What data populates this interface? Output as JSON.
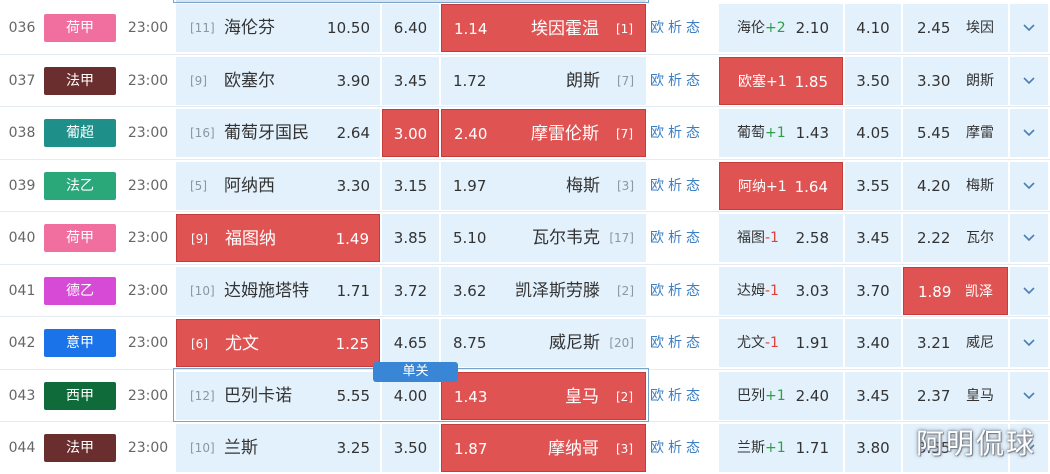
{
  "colors": {
    "cell_bg": "#e3f1fc",
    "selected_bg": "#e05353",
    "link": "#3b7fc4",
    "plus": "#2ea043",
    "minus": "#e0413a"
  },
  "links": {
    "ou": "欧",
    "xi": "析",
    "tai": "态"
  },
  "badge": "单关",
  "watermark": "阿明侃球",
  "expand_icon": "chevron-down-icon",
  "matches": [
    {
      "num": "036",
      "league": "荷甲",
      "league_color": "#f06f9e",
      "time": "23:00",
      "home_rank": "[11]",
      "home": "海伦芬",
      "home_odd": "10.50",
      "draw_odd": "6.40",
      "away_odd": "1.14",
      "away": "埃因霍温",
      "away_rank": "[1]",
      "hc_team": "海伦",
      "hc_sign": "+2",
      "hc_win": "2.10",
      "hc_draw": "4.10",
      "hc_lose": "2.45",
      "hc_away": "埃因",
      "sel": [
        "away"
      ],
      "hsel": []
    },
    {
      "num": "037",
      "league": "法甲",
      "league_color": "#6b2e2e",
      "time": "23:00",
      "home_rank": "[9]",
      "home": "欧塞尔",
      "home_odd": "3.90",
      "draw_odd": "3.45",
      "away_odd": "1.72",
      "away": "朗斯",
      "away_rank": "[7]",
      "hc_team": "欧塞",
      "hc_sign": "+1",
      "hc_win": "1.85",
      "hc_draw": "3.50",
      "hc_lose": "3.30",
      "hc_away": "朗斯",
      "sel": [],
      "hsel": [
        "c1"
      ]
    },
    {
      "num": "038",
      "league": "葡超",
      "league_color": "#1f8f8a",
      "time": "23:00",
      "home_rank": "[16]",
      "home": "葡萄牙国民",
      "home_odd": "2.64",
      "draw_odd": "3.00",
      "away_odd": "2.40",
      "away": "摩雷伦斯",
      "away_rank": "[7]",
      "hc_team": "葡萄",
      "hc_sign": "+1",
      "hc_win": "1.43",
      "hc_draw": "4.05",
      "hc_lose": "5.45",
      "hc_away": "摩雷",
      "sel": [
        "draw",
        "away"
      ],
      "hsel": []
    },
    {
      "num": "039",
      "league": "法乙",
      "league_color": "#2aa87a",
      "time": "23:00",
      "home_rank": "[5]",
      "home": "阿纳西",
      "home_odd": "3.30",
      "draw_odd": "3.15",
      "away_odd": "1.97",
      "away": "梅斯",
      "away_rank": "[3]",
      "hc_team": "阿纳",
      "hc_sign": "+1",
      "hc_win": "1.64",
      "hc_draw": "3.55",
      "hc_lose": "4.20",
      "hc_away": "梅斯",
      "sel": [],
      "hsel": [
        "c1"
      ]
    },
    {
      "num": "040",
      "league": "荷甲",
      "league_color": "#f06f9e",
      "time": "23:00",
      "home_rank": "[9]",
      "home": "福图纳",
      "home_odd": "1.49",
      "draw_odd": "3.85",
      "away_odd": "5.10",
      "away": "瓦尔韦克",
      "away_rank": "[17]",
      "hc_team": "福图",
      "hc_sign": "-1",
      "hc_win": "2.58",
      "hc_draw": "3.45",
      "hc_lose": "2.22",
      "hc_away": "瓦尔",
      "sel": [
        "home"
      ],
      "hsel": []
    },
    {
      "num": "041",
      "league": "德乙",
      "league_color": "#d64ad6",
      "time": "23:00",
      "home_rank": "[10]",
      "home": "达姆施塔特",
      "home_odd": "1.71",
      "draw_odd": "3.72",
      "away_odd": "3.62",
      "away": "凯泽斯劳滕",
      "away_rank": "[2]",
      "hc_team": "达姆",
      "hc_sign": "-1",
      "hc_win": "3.03",
      "hc_draw": "3.70",
      "hc_lose": "1.89",
      "hc_away": "凯泽",
      "sel": [],
      "hsel": [
        "c3"
      ]
    },
    {
      "num": "042",
      "league": "意甲",
      "league_color": "#1a73e8",
      "time": "23:00",
      "home_rank": "[6]",
      "home": "尤文",
      "home_odd": "1.25",
      "draw_odd": "4.65",
      "away_odd": "8.75",
      "away": "威尼斯",
      "away_rank": "[20]",
      "hc_team": "尤文",
      "hc_sign": "-1",
      "hc_win": "1.91",
      "hc_draw": "3.40",
      "hc_lose": "3.21",
      "hc_away": "威尼",
      "sel": [
        "home"
      ],
      "hsel": []
    },
    {
      "num": "043",
      "league": "西甲",
      "league_color": "#0f6b3a",
      "time": "23:00",
      "home_rank": "[12]",
      "home": "巴列卡诺",
      "home_odd": "5.55",
      "draw_odd": "4.00",
      "away_odd": "1.43",
      "away": "皇马",
      "away_rank": "[2]",
      "hc_team": "巴列",
      "hc_sign": "+1",
      "hc_win": "2.40",
      "hc_draw": "3.45",
      "hc_lose": "2.37",
      "hc_away": "皇马",
      "sel": [
        "away"
      ],
      "hsel": []
    },
    {
      "num": "044",
      "league": "法甲",
      "league_color": "#6b2e2e",
      "time": "23:00",
      "home_rank": "[10]",
      "home": "兰斯",
      "home_odd": "3.25",
      "draw_odd": "3.50",
      "away_odd": "1.87",
      "away": "摩纳哥",
      "away_rank": "[3]",
      "hc_team": "兰斯",
      "hc_sign": "+1",
      "hc_win": "1.71",
      "hc_draw": "3.80",
      "hc_lose": "3.55",
      "hc_away": "",
      "sel": [
        "away"
      ],
      "hsel": []
    }
  ]
}
